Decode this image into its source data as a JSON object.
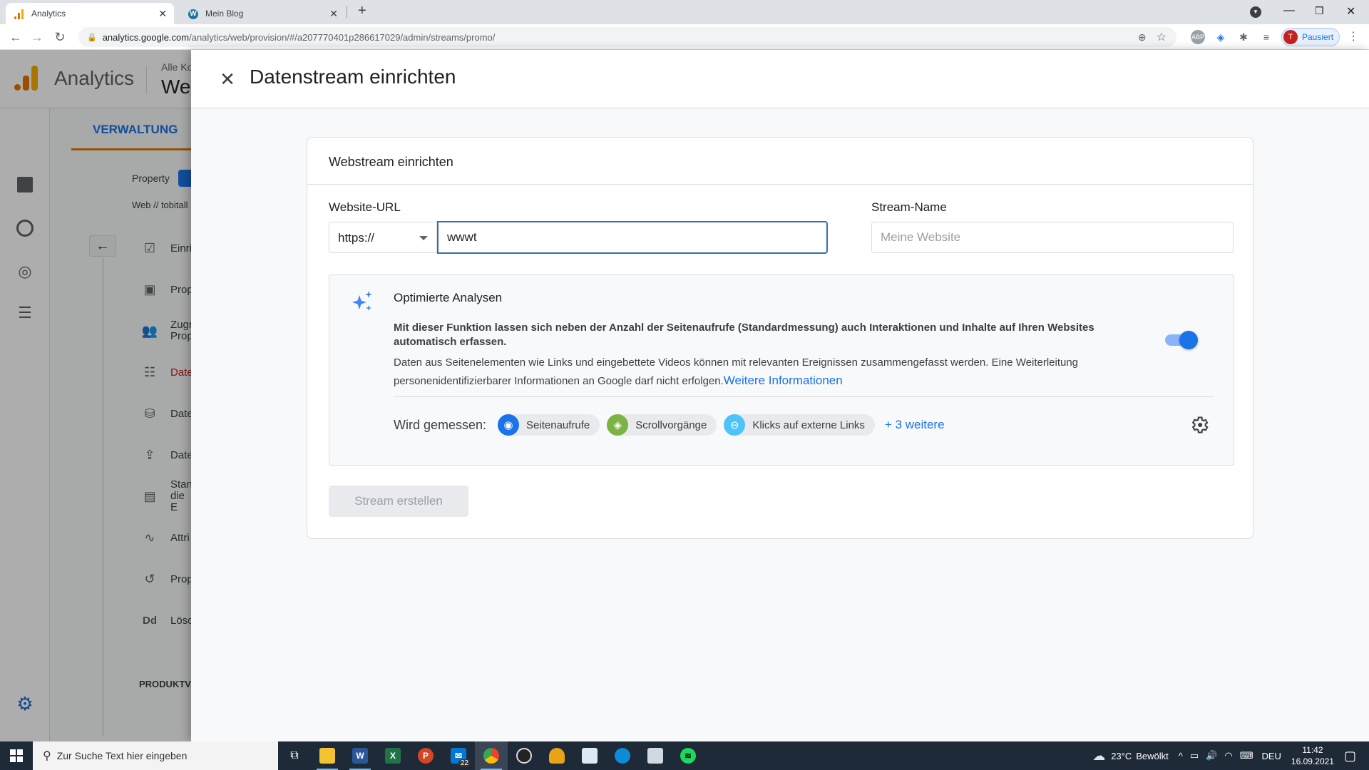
{
  "browser": {
    "tabs": [
      {
        "label": "Analytics",
        "icon": "analytics-logo-icon",
        "active": true
      },
      {
        "label": "Mein Blog",
        "icon": "wordpress-icon",
        "active": false
      }
    ],
    "new_tab_label": "+",
    "url": {
      "host": "analytics.google.com",
      "path": "/analytics/web/provision/#/a207770401p286617029/admin/streams/promo/"
    },
    "profile": {
      "initial": "T",
      "label": "Pausiert"
    },
    "extensions": [
      "zoom-icon",
      "star-icon",
      "abp-icon",
      "tag-icon",
      "puzzle-icon",
      "media-icon"
    ]
  },
  "ga": {
    "product": "Analytics",
    "account_crumb": "Alle Ko",
    "property_title": "We",
    "admin_tab": "VERWALTUNG",
    "property_label": "Property",
    "property_value": "Web // tobitall",
    "admin_items": [
      {
        "label": "Einri",
        "icon": "clipboard-check-icon"
      },
      {
        "label": "Prop",
        "icon": "layout-icon"
      },
      {
        "label": "Zugr Prop",
        "icon": "people-icon"
      },
      {
        "label": "Date",
        "icon": "data-streams-icon",
        "active": true
      },
      {
        "label": "Date",
        "icon": "database-icon"
      },
      {
        "label": "Date",
        "icon": "upload-icon"
      },
      {
        "label": "Stan die E",
        "icon": "id-card-icon"
      },
      {
        "label": "Attri",
        "icon": "route-icon"
      },
      {
        "label": "Prop",
        "icon": "history-icon"
      },
      {
        "label": "Lösc",
        "icon": "dd-icon"
      }
    ],
    "section_label": "PRODUKTVI"
  },
  "dialog": {
    "title": "Datenstream einrichten",
    "card_title": "Webstream einrichten",
    "website_url_label": "Website-URL",
    "protocol": "https://",
    "url_value": "wwwt",
    "stream_name_label": "Stream-Name",
    "stream_name_placeholder": "Meine Website",
    "enhanced": {
      "title": "Optimierte Analysen",
      "bold_text": "Mit dieser Funktion lassen sich neben der Anzahl der Seitenaufrufe (Standardmessung) auch Interaktionen und Inhalte auf Ihren Websites automatisch erfassen.",
      "text": "Daten aus Seitenelementen wie Links und eingebettete Videos können mit relevanten Ereignissen zusammengefasst werden. Eine Weiterleitung personenidentifizierbarer Informationen an Google darf nicht erfolgen.",
      "link": "Weitere Informationen",
      "toggle_on": true,
      "measured_label": "Wird gemessen:",
      "chips": [
        {
          "label": "Seitenaufrufe",
          "icon": "eye-icon",
          "color": "#1a73e8"
        },
        {
          "label": "Scrollvorgänge",
          "icon": "scroll-icon",
          "color": "#7cb342"
        },
        {
          "label": "Klicks auf externe Links",
          "icon": "mouse-icon",
          "color": "#4fc3f7"
        }
      ],
      "more": "+ 3 weitere"
    },
    "create_button": "Stream erstellen"
  },
  "taskbar": {
    "search_placeholder": "Zur Suche Text hier eingeben",
    "mail_badge": "22",
    "weather": "23°C",
    "weather_text": "Bewölkt",
    "lang": "DEU",
    "time": "11:42",
    "date": "16.09.2021"
  }
}
